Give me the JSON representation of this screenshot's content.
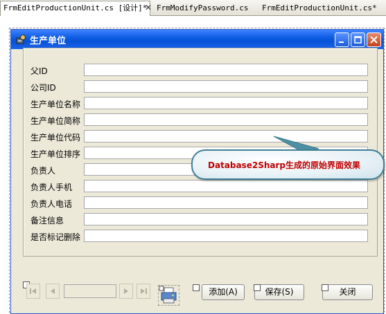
{
  "tabs": [
    {
      "label": "FrmEditProductionUnit.cs [设计]*",
      "active": true
    },
    {
      "label": "FrmModifyPassword.cs",
      "active": false
    },
    {
      "label": "FrmEditProductionUnit.cs*",
      "active": false
    }
  ],
  "window": {
    "title": "生产单位"
  },
  "fields": [
    {
      "label": "父ID",
      "value": ""
    },
    {
      "label": "公司ID",
      "value": ""
    },
    {
      "label": "生产单位名称",
      "value": ""
    },
    {
      "label": "生产单位简称",
      "value": ""
    },
    {
      "label": "生产单位代码",
      "value": ""
    },
    {
      "label": "生产单位排序",
      "value": ""
    },
    {
      "label": "负责人",
      "value": ""
    },
    {
      "label": "负责人手机",
      "value": ""
    },
    {
      "label": "负责人电话",
      "value": ""
    },
    {
      "label": "备注信息",
      "value": ""
    },
    {
      "label": "是否标记删除",
      "value": ""
    }
  ],
  "buttons": {
    "add": "添加(A)",
    "save": "保存(S)",
    "close": "关闭"
  },
  "callout": {
    "text": "Database2Sharp生成的原始界面效果"
  },
  "icons": {
    "tab_close": "close-icon",
    "window_min": "minimize-icon",
    "window_max": "maximize-icon",
    "window_close": "close-icon",
    "printer": "printer-icon"
  }
}
